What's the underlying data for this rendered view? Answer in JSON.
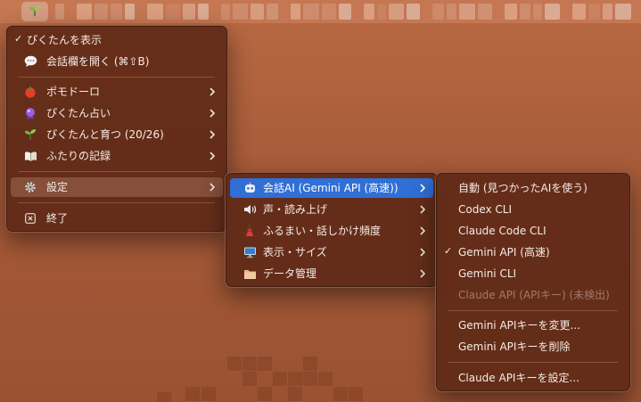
{
  "menubar": {
    "app_icon": "sprout-icon"
  },
  "main_menu": {
    "items": [
      {
        "label": "ぴくたんを表示",
        "checked": true
      },
      {
        "label": "会話欄を開く (⌘⇧B)",
        "icon": "speech-bubble-icon"
      },
      {
        "label": "ポモドーロ",
        "icon": "tomato-icon"
      },
      {
        "label": "ぴくたん占い",
        "icon": "crystal-ball-icon"
      },
      {
        "label": "ぴくたんと育つ (20/26)",
        "icon": "sprout-icon"
      },
      {
        "label": "ふたりの記録",
        "icon": "book-icon"
      },
      {
        "label": "設定",
        "icon": "gear-icon",
        "highlighted": true
      },
      {
        "label": "終了",
        "icon": "close-box-icon"
      }
    ]
  },
  "settings_menu": {
    "items": [
      {
        "label": "会話AI (Gemini API (高速))",
        "icon": "robot-icon",
        "selected": true
      },
      {
        "label": "声・読み上げ",
        "icon": "speaker-icon"
      },
      {
        "label": "ふるまい・話しかけ頻度",
        "icon": "dancer-icon"
      },
      {
        "label": "表示・サイズ",
        "icon": "monitor-icon"
      },
      {
        "label": "データ管理",
        "icon": "folder-icon"
      }
    ]
  },
  "ai_menu": {
    "items": [
      {
        "label": "自動 (見つかったAIを使う)"
      },
      {
        "label": "Codex CLI"
      },
      {
        "label": "Claude Code CLI"
      },
      {
        "label": "Gemini API (高速)",
        "checked": true
      },
      {
        "label": "Gemini CLI"
      },
      {
        "label": "Claude API (APIキー) (未検出)",
        "disabled": true
      },
      {
        "label": "Gemini APIキーを変更..."
      },
      {
        "label": "Gemini APIキーを削除"
      },
      {
        "label": "Claude APIキーを設定..."
      }
    ]
  },
  "colors": {
    "menu_background": "#602a17",
    "selection": "#2f6fd6",
    "desktop": "#b06240"
  }
}
